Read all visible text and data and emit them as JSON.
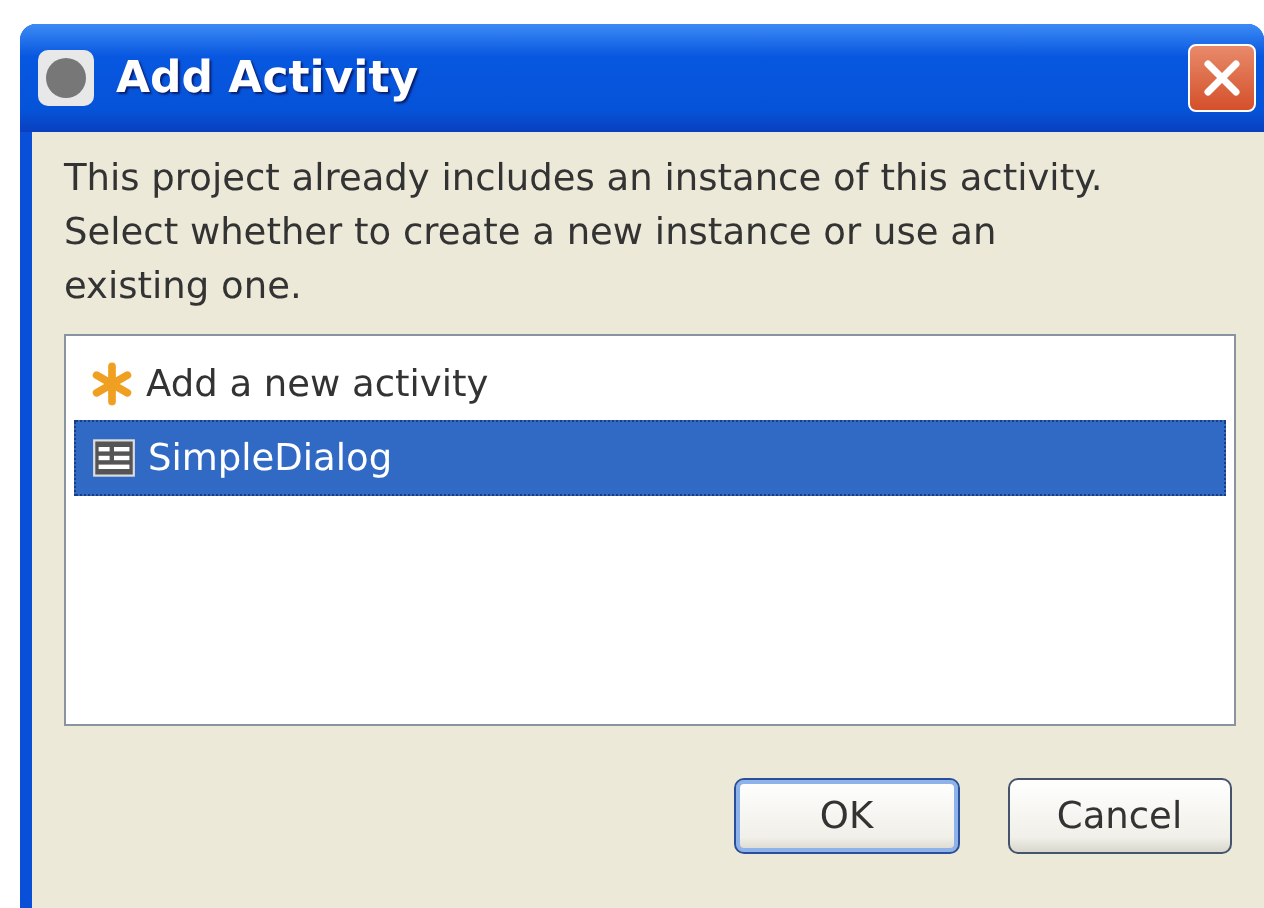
{
  "window": {
    "title": "Add Activity"
  },
  "message": "This project already includes an instance of this activity. Select whether to create a new instance or use an existing one.",
  "items": [
    {
      "kind": "new",
      "label": "Add a new activity",
      "selected": false
    },
    {
      "kind": "existing",
      "label": "SimpleDialog",
      "selected": true
    }
  ],
  "buttons": [
    {
      "label": "OK",
      "default": true
    },
    {
      "label": "Cancel",
      "default": false
    }
  ]
}
